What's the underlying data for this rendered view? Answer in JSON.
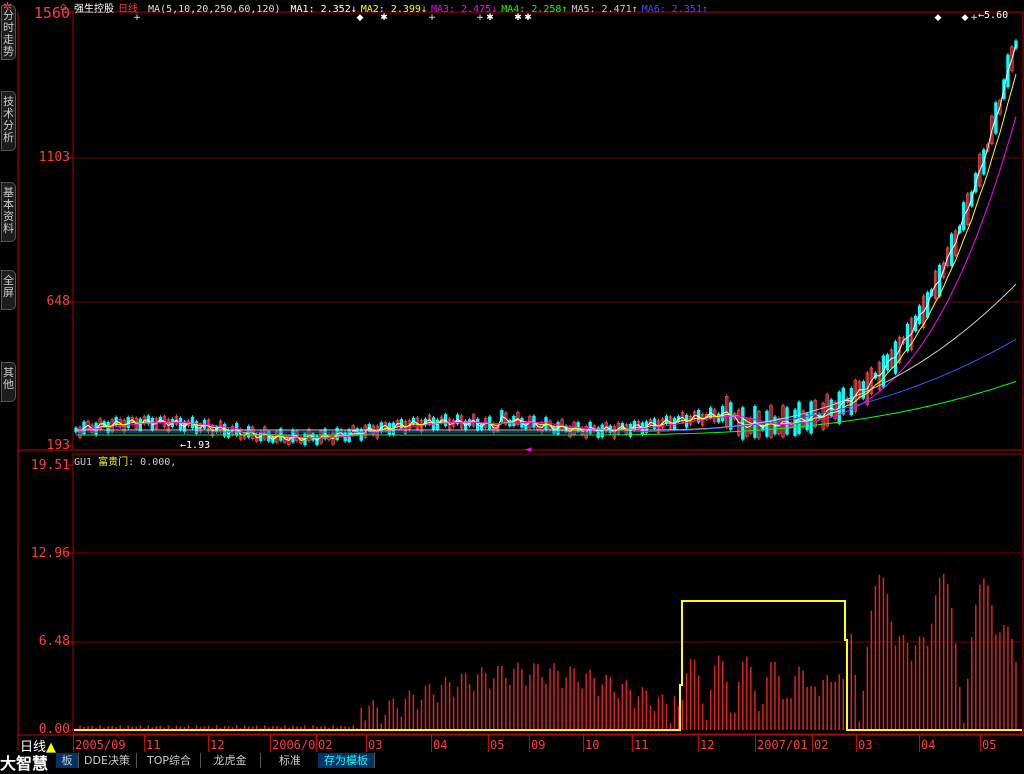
{
  "header": {
    "stock_name": "强生控股",
    "period": "日线",
    "ma_params": "MA(5,10,20,250,60,120)",
    "ma_values": [
      {
        "label": "MA1:",
        "value": "2.352",
        "arrow": "↓",
        "color": "#ffffff"
      },
      {
        "label": "MA2:",
        "value": "2.399",
        "arrow": "↓",
        "color": "#ffff00"
      },
      {
        "label": "MA3:",
        "value": "2.475",
        "arrow": "↓",
        "color": "#ff00ff"
      },
      {
        "label": "MA4:",
        "value": "2.258",
        "arrow": "↑",
        "color": "#00ff00"
      },
      {
        "label": "MA5:",
        "value": "2.471",
        "arrow": "↑",
        "color": "#cccccc"
      },
      {
        "label": "MA6:",
        "value": "2.351",
        "arrow": "↑",
        "color": "#3355ff"
      }
    ],
    "max_price_label": "5.60",
    "min_price_label": "1.93"
  },
  "side_tabs": [
    "分时走势",
    "技术分析",
    "基本资料",
    "全屏",
    "其他"
  ],
  "price_axis": {
    "ticks": [
      "1560",
      "1103",
      "648",
      "193"
    ]
  },
  "indicator": {
    "name": "GU1",
    "series_label": "富贵门:",
    "series_value": "0.000,",
    "ticks": [
      "19.51",
      "12.96",
      "6.48",
      "0.00"
    ]
  },
  "x_axis": {
    "labels": [
      "2005/09",
      "11",
      "12",
      "2006/0",
      "02",
      "03",
      "04",
      "05",
      "09",
      "10",
      "11",
      "12",
      "2007/01",
      "02",
      "03",
      "04",
      "05"
    ]
  },
  "bottom": {
    "period_label": "日线",
    "brand": "大智慧",
    "tabs": [
      "板",
      "DDE决策",
      "TOP综合",
      "龙虎金",
      "标准",
      "存为模板"
    ]
  },
  "chart_data": {
    "type": "candlestick",
    "price_axis": {
      "ylim": [
        193,
        1560
      ],
      "ticks": [
        1560,
        1103,
        648,
        193
      ]
    },
    "indicator_axis": {
      "ylim": [
        0,
        19.51
      ],
      "ticks": [
        19.51,
        12.96,
        6.48,
        0.0
      ]
    },
    "moving_average_colors": [
      "#ffffff",
      "#ffff00",
      "#ff00ff",
      "#00ff00",
      "#cccccc",
      "#3355ff"
    ],
    "step_line": {
      "color": "#ffff00",
      "value": 9.5
    }
  }
}
